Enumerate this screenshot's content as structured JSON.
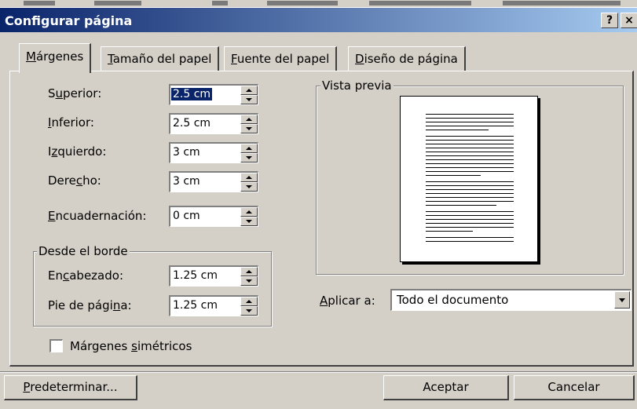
{
  "window": {
    "title": "Configurar página",
    "help_label": "?",
    "close_label": "×"
  },
  "tabs": [
    {
      "prefix": "",
      "mnemonic": "M",
      "rest": "árgenes",
      "active": true
    },
    {
      "prefix": "",
      "mnemonic": "T",
      "rest": "amaño del papel",
      "active": false
    },
    {
      "prefix": "",
      "mnemonic": "F",
      "rest": "uente del papel",
      "active": false
    },
    {
      "prefix": "",
      "mnemonic": "D",
      "rest": "iseño de página",
      "active": false
    }
  ],
  "margins": {
    "superior": {
      "pre": "S",
      "mn": "u",
      "post": "perior:",
      "value": "2.5 cm"
    },
    "inferior": {
      "pre": "",
      "mn": "I",
      "post": "nferior:",
      "value": "2.5 cm"
    },
    "izquierdo": {
      "pre": "I",
      "mn": "z",
      "post": "quierdo:",
      "value": "3 cm"
    },
    "derecho": {
      "pre": "Dere",
      "mn": "c",
      "post": "ho:",
      "value": "3 cm"
    },
    "encuadernacion": {
      "pre": "",
      "mn": "E",
      "post": "ncuadernación:",
      "value": "0 cm"
    }
  },
  "from_edge": {
    "legend": "Desde el borde",
    "encabezado": {
      "pre": "En",
      "mn": "c",
      "post": "abezado:",
      "value": "1.25 cm"
    },
    "pie": {
      "pre": "Pie de pági",
      "mn": "n",
      "post": "a:",
      "value": "1.25 cm"
    }
  },
  "preview": {
    "legend": "Vista previa"
  },
  "apply": {
    "pre": "",
    "mn": "A",
    "post": "plicar a:",
    "value": "Todo el documento"
  },
  "mirror": {
    "pre": "Márgenes ",
    "mn": "s",
    "post": "imétricos",
    "checked": false
  },
  "buttons": {
    "default": {
      "pre": "",
      "mn": "P",
      "post": "redeterminar..."
    },
    "ok": "Aceptar",
    "cancel": "Cancelar"
  }
}
